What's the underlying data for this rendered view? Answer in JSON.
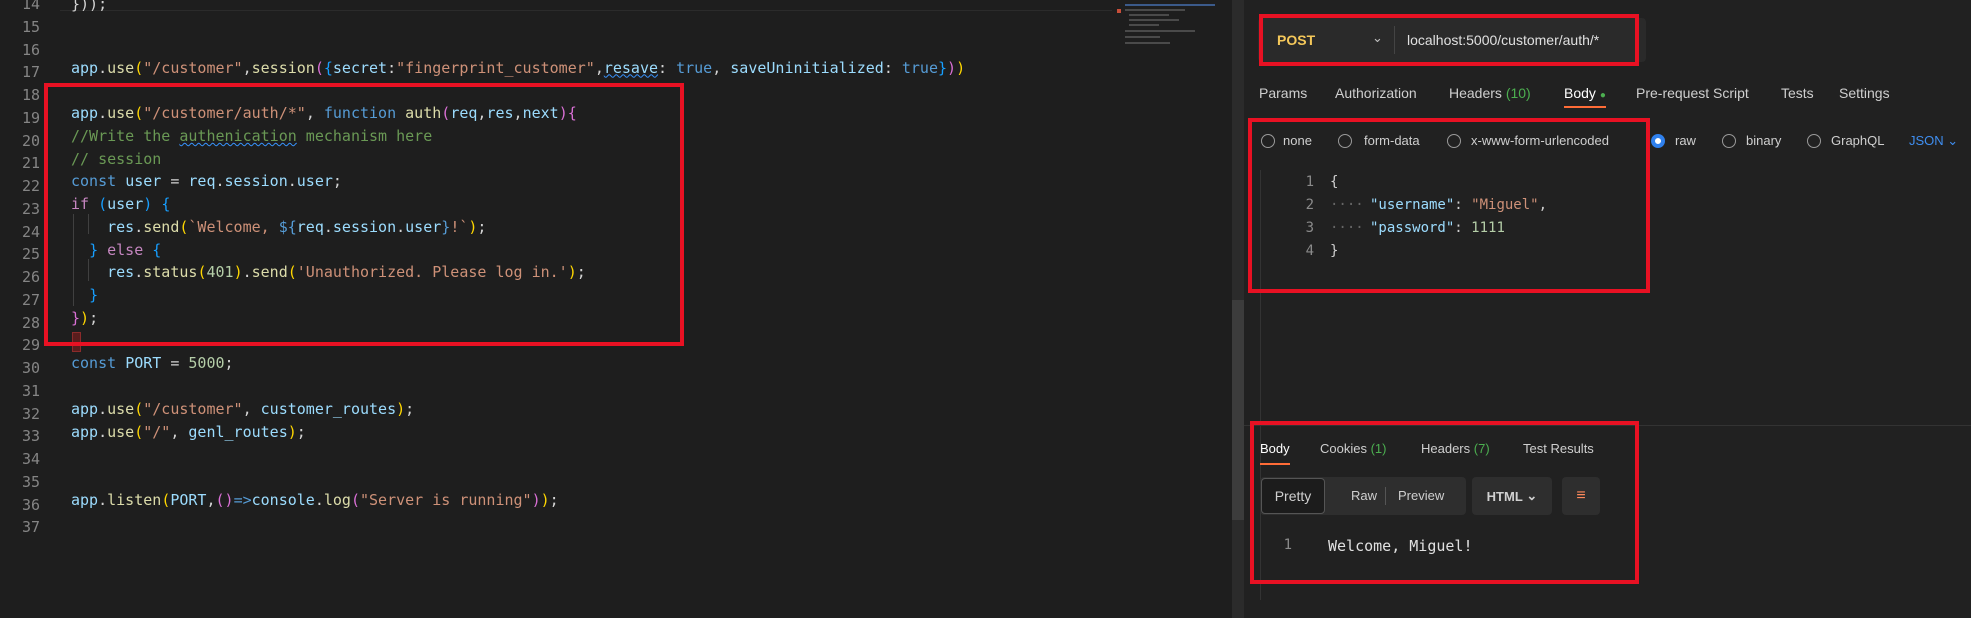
{
  "code": {
    "line_numbers": [
      "14",
      "15",
      "16",
      "17",
      "18",
      "19",
      "20",
      "21",
      "22",
      "23",
      "24",
      "25",
      "26",
      "27",
      "28",
      "29",
      "30",
      "31",
      "32",
      "33",
      "34",
      "35",
      "36",
      "37"
    ],
    "lines": {
      "l14": "}));",
      "l17": [
        {
          "t": "app",
          "c": "v"
        },
        {
          "t": ".",
          "c": ""
        },
        {
          "t": "use",
          "c": "f"
        },
        {
          "t": "(",
          "c": "p1"
        },
        {
          "t": "\"/customer\"",
          "c": "s"
        },
        {
          "t": ",",
          "c": ""
        },
        {
          "t": "session",
          "c": "f"
        },
        {
          "t": "(",
          "c": "p2"
        },
        {
          "t": "{",
          "c": "p3"
        },
        {
          "t": "secret",
          "c": "v"
        },
        {
          "t": ":",
          "c": ""
        },
        {
          "t": "\"fingerprint_customer\"",
          "c": "s"
        },
        {
          "t": ",",
          "c": ""
        },
        {
          "t": "resave",
          "c": "v sq"
        },
        {
          "t": ": ",
          "c": ""
        },
        {
          "t": "true",
          "c": "k"
        },
        {
          "t": ", ",
          "c": ""
        },
        {
          "t": "saveUninitialized",
          "c": "v"
        },
        {
          "t": ": ",
          "c": ""
        },
        {
          "t": "true",
          "c": "k"
        },
        {
          "t": "}",
          "c": "p3"
        },
        {
          "t": ")",
          "c": "p2"
        },
        {
          "t": ")",
          "c": "p1"
        }
      ],
      "l19": [
        {
          "t": "app",
          "c": "v"
        },
        {
          "t": ".",
          "c": ""
        },
        {
          "t": "use",
          "c": "f"
        },
        {
          "t": "(",
          "c": "p1"
        },
        {
          "t": "\"/customer/auth/*\"",
          "c": "s"
        },
        {
          "t": ", ",
          "c": ""
        },
        {
          "t": "function",
          "c": "k"
        },
        {
          "t": " ",
          "c": ""
        },
        {
          "t": "auth",
          "c": "f"
        },
        {
          "t": "(",
          "c": "p2"
        },
        {
          "t": "req",
          "c": "v"
        },
        {
          "t": ",",
          "c": ""
        },
        {
          "t": "res",
          "c": "v"
        },
        {
          "t": ",",
          "c": ""
        },
        {
          "t": "next",
          "c": "v"
        },
        {
          "t": ")",
          "c": "p2"
        },
        {
          "t": "{",
          "c": "p2"
        }
      ],
      "l20": [
        {
          "t": "//Write the ",
          "c": "c"
        },
        {
          "t": "authenication",
          "c": "c sq"
        },
        {
          "t": " mechanism here",
          "c": "c"
        }
      ],
      "l21": [
        {
          "t": "// session",
          "c": "c"
        }
      ],
      "l22": [
        {
          "t": "const",
          "c": "k"
        },
        {
          "t": " ",
          "c": ""
        },
        {
          "t": "user",
          "c": "v"
        },
        {
          "t": " = ",
          "c": ""
        },
        {
          "t": "req",
          "c": "v"
        },
        {
          "t": ".",
          "c": ""
        },
        {
          "t": "session",
          "c": "v"
        },
        {
          "t": ".",
          "c": ""
        },
        {
          "t": "user",
          "c": "v"
        },
        {
          "t": ";",
          "c": ""
        }
      ],
      "l23": [
        {
          "t": "if",
          "c": "kc"
        },
        {
          "t": " ",
          "c": ""
        },
        {
          "t": "(",
          "c": "p3"
        },
        {
          "t": "user",
          "c": "v"
        },
        {
          "t": ")",
          "c": "p3"
        },
        {
          "t": " ",
          "c": ""
        },
        {
          "t": "{",
          "c": "p3"
        }
      ],
      "l24": [
        {
          "t": "    res",
          "c": "v"
        },
        {
          "t": ".",
          "c": ""
        },
        {
          "t": "send",
          "c": "f"
        },
        {
          "t": "(",
          "c": "p1"
        },
        {
          "t": "`Welcome, ",
          "c": "s"
        },
        {
          "t": "${",
          "c": "k"
        },
        {
          "t": "req",
          "c": "v"
        },
        {
          "t": ".",
          "c": ""
        },
        {
          "t": "session",
          "c": "v"
        },
        {
          "t": ".",
          "c": ""
        },
        {
          "t": "user",
          "c": "v"
        },
        {
          "t": "}",
          "c": "k"
        },
        {
          "t": "!`",
          "c": "s"
        },
        {
          "t": ")",
          "c": "p1"
        },
        {
          "t": ";",
          "c": ""
        }
      ],
      "l25": [
        {
          "t": "  ",
          "c": ""
        },
        {
          "t": "}",
          "c": "p3"
        },
        {
          "t": " ",
          "c": ""
        },
        {
          "t": "else",
          "c": "kc"
        },
        {
          "t": " ",
          "c": ""
        },
        {
          "t": "{",
          "c": "p3"
        }
      ],
      "l26": [
        {
          "t": "    res",
          "c": "v"
        },
        {
          "t": ".",
          "c": ""
        },
        {
          "t": "status",
          "c": "f"
        },
        {
          "t": "(",
          "c": "p1"
        },
        {
          "t": "401",
          "c": "n"
        },
        {
          "t": ")",
          "c": "p1"
        },
        {
          "t": ".",
          "c": ""
        },
        {
          "t": "send",
          "c": "f"
        },
        {
          "t": "(",
          "c": "p1"
        },
        {
          "t": "'Unauthorized. Please log in.'",
          "c": "s"
        },
        {
          "t": ")",
          "c": "p1"
        },
        {
          "t": ";",
          "c": ""
        }
      ],
      "l27": [
        {
          "t": "  ",
          "c": ""
        },
        {
          "t": "}",
          "c": "p3"
        }
      ],
      "l28": [
        {
          "t": "}",
          "c": "p2"
        },
        {
          "t": ")",
          "c": "p1"
        },
        {
          "t": ";",
          "c": ""
        }
      ],
      "l30": [
        {
          "t": "const",
          "c": "k"
        },
        {
          "t": " ",
          "c": ""
        },
        {
          "t": "PORT",
          "c": "v"
        },
        {
          "t": " = ",
          "c": ""
        },
        {
          "t": "5000",
          "c": "n"
        },
        {
          "t": ";",
          "c": ""
        }
      ],
      "l32": [
        {
          "t": "app",
          "c": "v"
        },
        {
          "t": ".",
          "c": ""
        },
        {
          "t": "use",
          "c": "f"
        },
        {
          "t": "(",
          "c": "p1"
        },
        {
          "t": "\"/customer\"",
          "c": "s"
        },
        {
          "t": ", ",
          "c": ""
        },
        {
          "t": "customer_routes",
          "c": "v"
        },
        {
          "t": ")",
          "c": "p1"
        },
        {
          "t": ";",
          "c": ""
        }
      ],
      "l33": [
        {
          "t": "app",
          "c": "v"
        },
        {
          "t": ".",
          "c": ""
        },
        {
          "t": "use",
          "c": "f"
        },
        {
          "t": "(",
          "c": "p1"
        },
        {
          "t": "\"/\"",
          "c": "s"
        },
        {
          "t": ", ",
          "c": ""
        },
        {
          "t": "genl_routes",
          "c": "v"
        },
        {
          "t": ")",
          "c": "p1"
        },
        {
          "t": ";",
          "c": ""
        }
      ],
      "l36": [
        {
          "t": "app",
          "c": "v"
        },
        {
          "t": ".",
          "c": ""
        },
        {
          "t": "listen",
          "c": "f"
        },
        {
          "t": "(",
          "c": "p1"
        },
        {
          "t": "PORT",
          "c": "v"
        },
        {
          "t": ",",
          "c": ""
        },
        {
          "t": "()",
          "c": "p2"
        },
        {
          "t": "=>",
          "c": "k"
        },
        {
          "t": "console",
          "c": "v"
        },
        {
          "t": ".",
          "c": ""
        },
        {
          "t": "log",
          "c": "f"
        },
        {
          "t": "(",
          "c": "p2"
        },
        {
          "t": "\"Server is running\"",
          "c": "s"
        },
        {
          "t": ")",
          "c": "p2"
        },
        {
          "t": ")",
          "c": "p1"
        },
        {
          "t": ";",
          "c": ""
        }
      ]
    }
  },
  "request": {
    "method": "POST",
    "url": "localhost:5000/customer/auth/*",
    "tabs": [
      "Params",
      "Authorization",
      "Headers",
      "Body",
      "Pre-request Script",
      "Tests",
      "Settings"
    ],
    "headers_count": "(10)",
    "active_tab": "Body",
    "body_types": [
      "none",
      "form-data",
      "x-www-form-urlencoded",
      "raw",
      "binary",
      "GraphQL"
    ],
    "selected_body_type": "raw",
    "format": "JSON",
    "body_lines": [
      "1",
      "2",
      "3",
      "4"
    ],
    "json": {
      "open": "{",
      "k1": "\"username\"",
      "v1": "\"Miguel\"",
      "k2": "\"password\"",
      "v2": "1111",
      "close": "}"
    }
  },
  "response": {
    "tabs": [
      "Body",
      "Cookies",
      "Headers",
      "Test Results"
    ],
    "cookies_count": "(1)",
    "headers_count": "(7)",
    "view_modes": [
      "Pretty",
      "Raw",
      "Preview"
    ],
    "format": "HTML",
    "line": "1",
    "text": "Welcome, Miguel!"
  },
  "colors": {
    "highlight_box": "#e81123",
    "method_post": "#f5c85a",
    "accent_tab": "#ff6c37",
    "radio_selected": "#2f80ed",
    "count_green": "#4caf50"
  }
}
